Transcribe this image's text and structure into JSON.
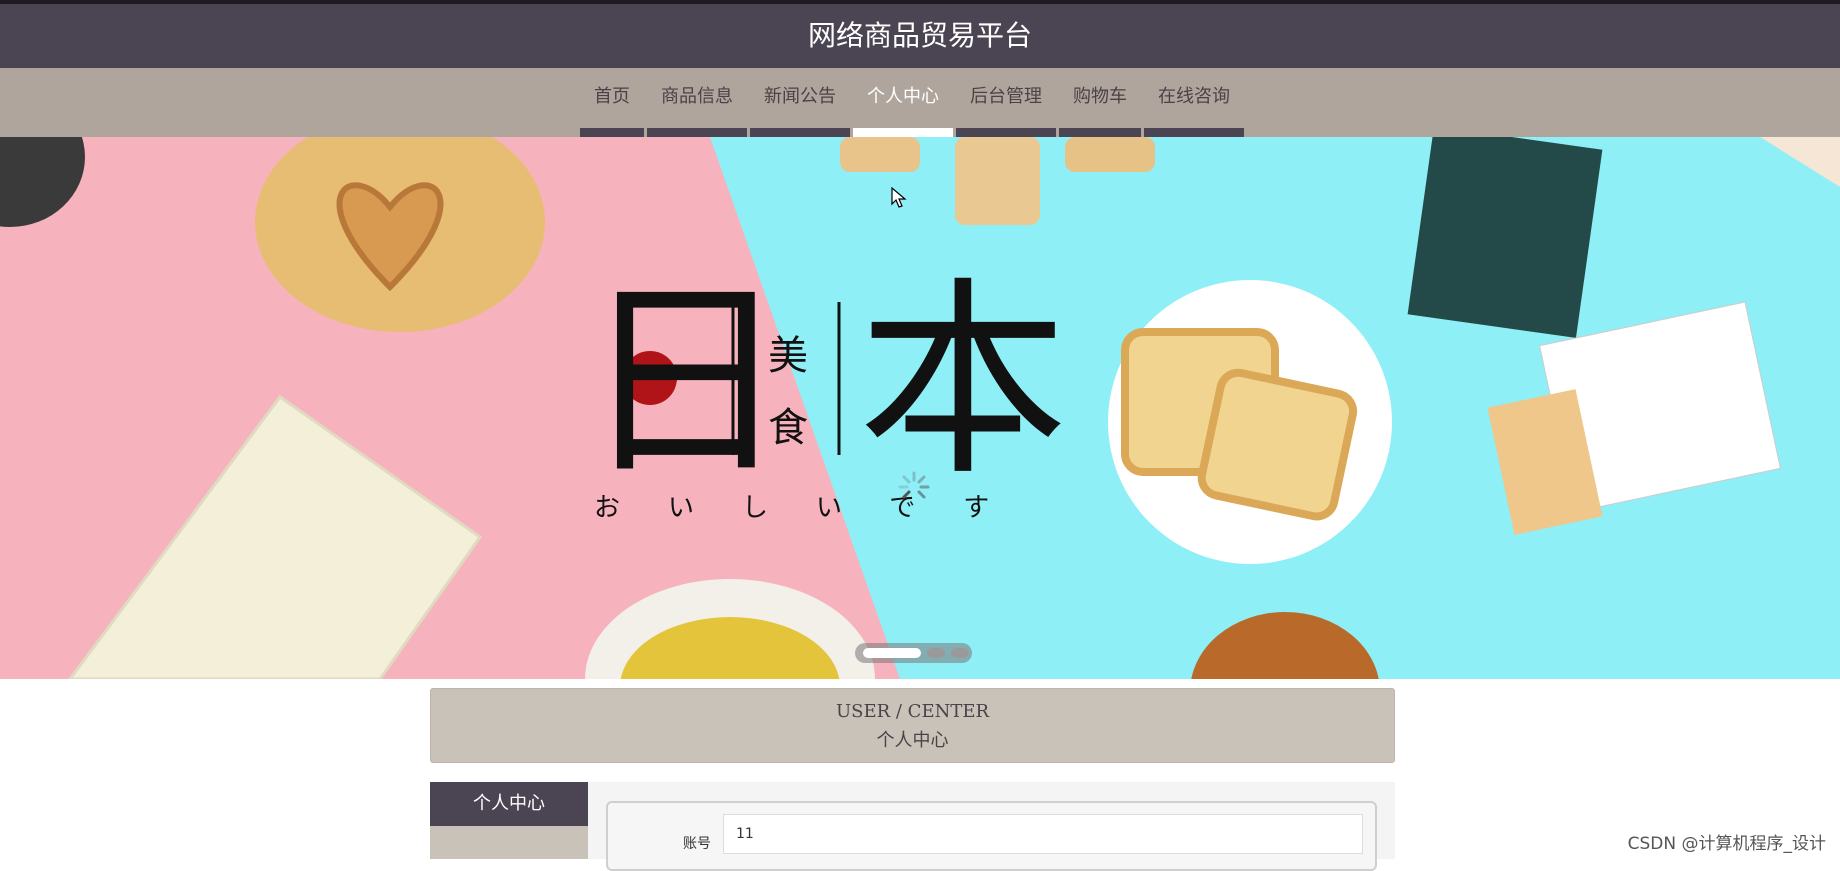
{
  "header": {
    "title": "网络商品贸易平台"
  },
  "nav": {
    "items": [
      {
        "label": "首页",
        "active": false
      },
      {
        "label": "商品信息",
        "active": false
      },
      {
        "label": "新闻公告",
        "active": false
      },
      {
        "label": "个人中心",
        "active": true
      },
      {
        "label": "后台管理",
        "active": false
      },
      {
        "label": "购物车",
        "active": false
      },
      {
        "label": "在线咨询",
        "active": false
      }
    ]
  },
  "banner": {
    "kanji_left": "日",
    "kanji_right": "本",
    "sub_top": "美",
    "sub_bottom": "食",
    "kana": "おいしいです",
    "carousel": {
      "total": 3,
      "active_index": 0
    }
  },
  "user_center": {
    "title_en": "USER / CENTER",
    "title_cn": "个人中心"
  },
  "sidebar": {
    "items": [
      {
        "label": "个人中心"
      }
    ]
  },
  "form": {
    "account_label": "账号",
    "account_value": "11"
  },
  "watermark": "CSDN @计算机程序_设计",
  "colors": {
    "header_bg": "#4b4452",
    "nav_bg": "#b0a59c",
    "user_center_bg": "#c9c2b8"
  }
}
